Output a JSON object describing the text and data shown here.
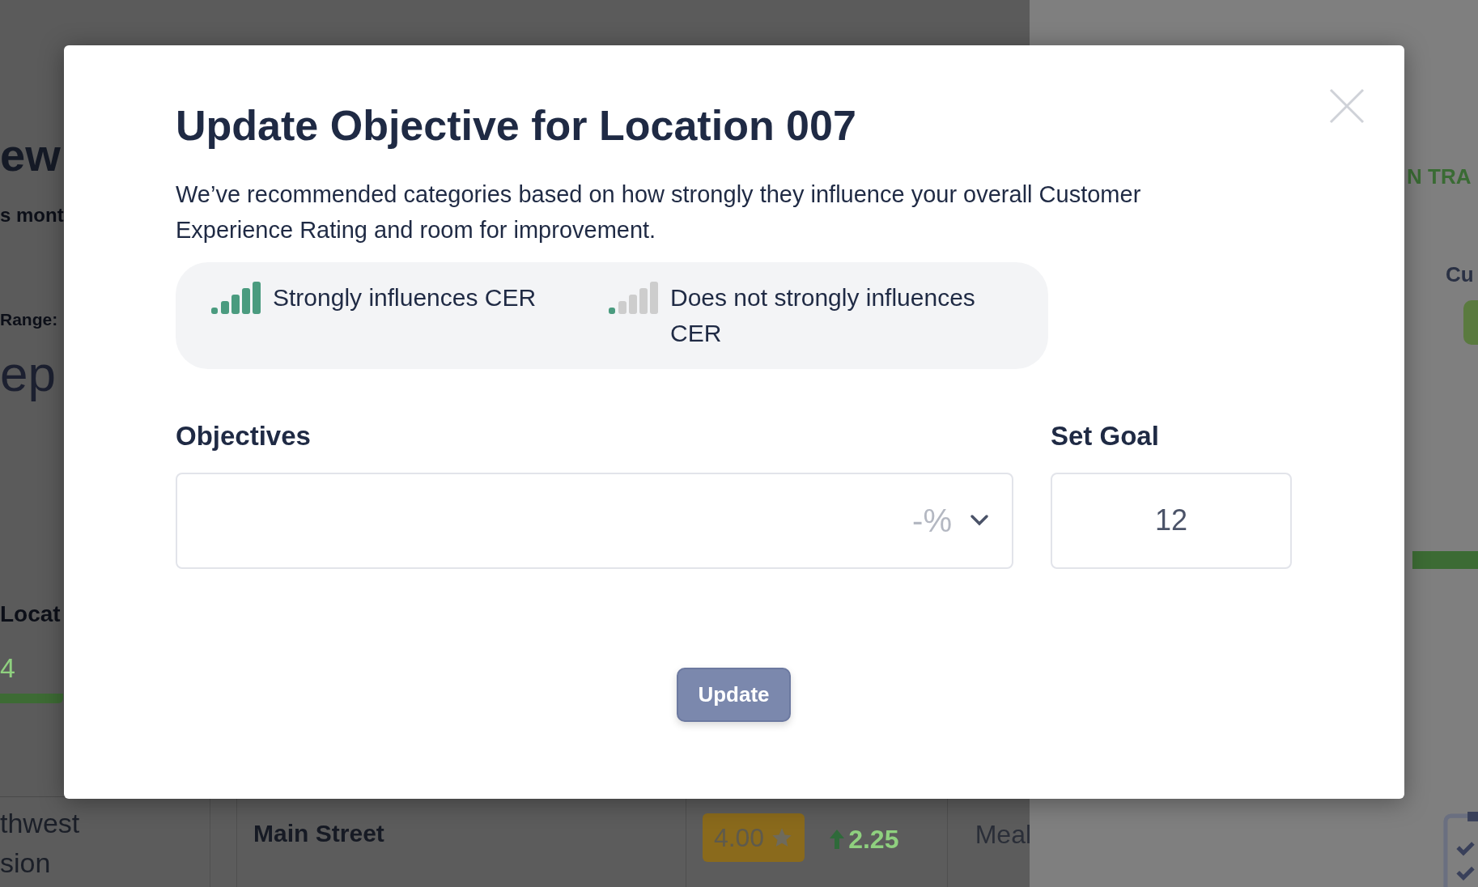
{
  "background": {
    "page_heading": "ew",
    "subtitle": "s mont",
    "range_label": "Range:",
    "range_value": "ep",
    "section_title": "Locat",
    "count": "4",
    "region_lines": [
      "thwest",
      "sion"
    ],
    "row": {
      "location": "Main Street",
      "rating": "4.00",
      "change": "2.25",
      "column_4": "Meal"
    }
  },
  "side_panel": {
    "status": "N TRA",
    "label": "Cu",
    "progress": {
      "level": 1
    }
  },
  "modal": {
    "title": "Update Objective for Location 007",
    "description": "We’ve recommended categories based on how strongly they influence your overall Customer Experience Rating and room for improvement.",
    "legend": [
      {
        "label": "Strongly influences CER",
        "strong": true
      },
      {
        "label": "Does not strongly influences CER",
        "strong": false
      }
    ],
    "objectives": {
      "label": "Objectives",
      "suffix": "-%"
    },
    "goal": {
      "label": "Set Goal",
      "value": "12"
    },
    "button": "Update"
  }
}
